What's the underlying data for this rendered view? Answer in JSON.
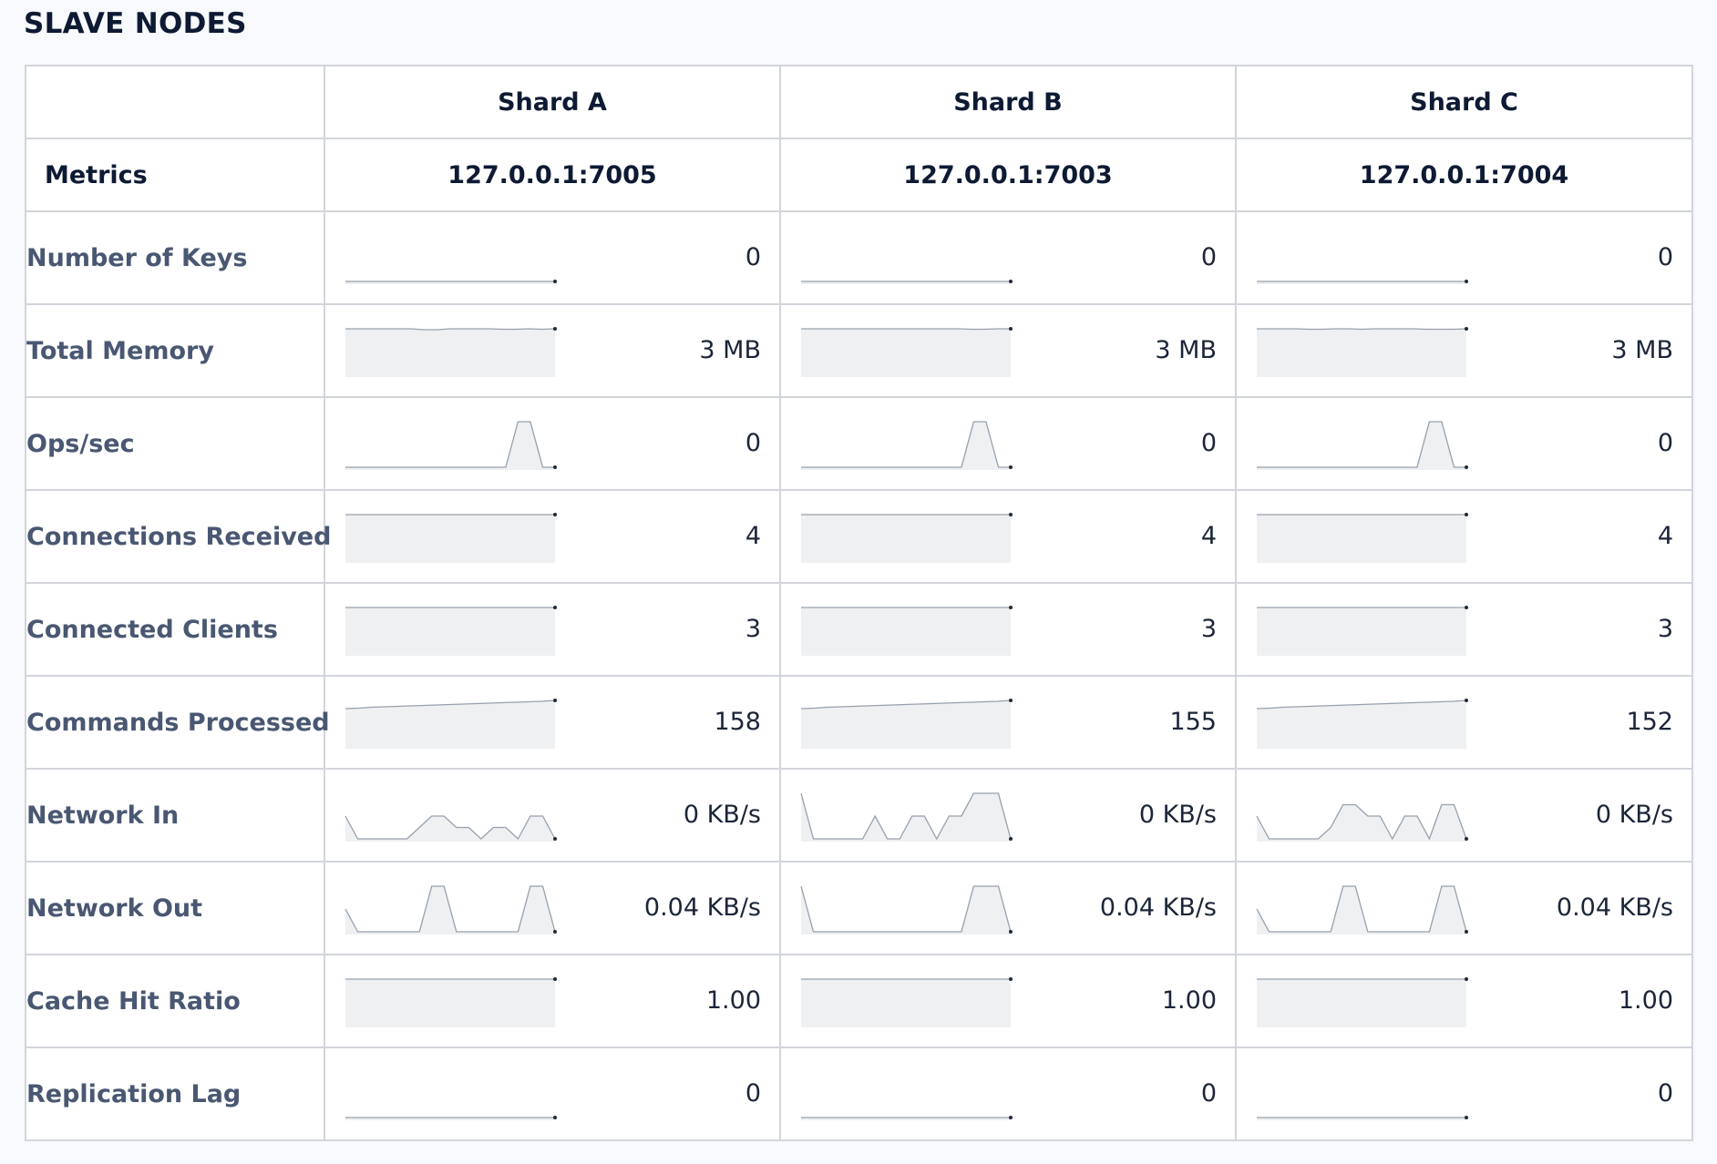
{
  "section_title": "SLAVE NODES",
  "metrics_label": "Metrics",
  "shards": [
    {
      "name": "Shard A",
      "address": "127.0.0.1:7005"
    },
    {
      "name": "Shard B",
      "address": "127.0.0.1:7003"
    },
    {
      "name": "Shard C",
      "address": "127.0.0.1:7004"
    }
  ],
  "rows": [
    {
      "label": "Number of Keys",
      "values": [
        "0",
        "0",
        "0"
      ],
      "series": [
        [
          0,
          0,
          0,
          0,
          0,
          0,
          0,
          0,
          0,
          0,
          0,
          0,
          0,
          0,
          0,
          0,
          0
        ],
        [
          0,
          0,
          0,
          0,
          0,
          0,
          0,
          0,
          0,
          0,
          0,
          0,
          0,
          0,
          0,
          0,
          0
        ],
        [
          0,
          0,
          0,
          0,
          0,
          0,
          0,
          0,
          0,
          0,
          0,
          0,
          0,
          0,
          0,
          0,
          0
        ]
      ]
    },
    {
      "label": "Total Memory",
      "values": [
        "3 MB",
        "3 MB",
        "3 MB"
      ],
      "series": [
        [
          1,
          1,
          1,
          1,
          1,
          1,
          0.98,
          0.98,
          1,
          1,
          1,
          1,
          0.99,
          0.99,
          1,
          0.99,
          1
        ],
        [
          1,
          1,
          1,
          1,
          1,
          1,
          1,
          1,
          1,
          1,
          1,
          1,
          1,
          0.99,
          0.99,
          1,
          1
        ],
        [
          1,
          1,
          1,
          1,
          0.99,
          0.99,
          1,
          1,
          0.99,
          1,
          1,
          1,
          1,
          0.99,
          0.99,
          0.99,
          1
        ]
      ]
    },
    {
      "label": "Ops/sec",
      "values": [
        "0",
        "0",
        "0"
      ],
      "series": [
        [
          0,
          0,
          0,
          0,
          0,
          0,
          0,
          0,
          0,
          0,
          0,
          0,
          0,
          0,
          1,
          1,
          0,
          0
        ],
        [
          0,
          0,
          0,
          0,
          0,
          0,
          0,
          0,
          0,
          0,
          0,
          0,
          0,
          0,
          1,
          1,
          0,
          0
        ],
        [
          0,
          0,
          0,
          0,
          0,
          0,
          0,
          0,
          0,
          0,
          0,
          0,
          0,
          0,
          1,
          1,
          0,
          0
        ]
      ]
    },
    {
      "label": "Connections Received",
      "values": [
        "4",
        "4",
        "4"
      ],
      "series": [
        [
          1,
          1,
          1,
          1,
          1,
          1,
          1,
          1,
          1,
          1,
          1,
          1,
          1,
          1,
          1,
          1,
          1
        ],
        [
          1,
          1,
          1,
          1,
          1,
          1,
          1,
          1,
          1,
          1,
          1,
          1,
          1,
          1,
          1,
          1,
          1
        ],
        [
          1,
          1,
          1,
          1,
          1,
          1,
          1,
          1,
          1,
          1,
          1,
          1,
          1,
          1,
          1,
          1,
          1
        ]
      ]
    },
    {
      "label": "Connected Clients",
      "values": [
        "3",
        "3",
        "3"
      ],
      "series": [
        [
          1,
          1,
          1,
          1,
          1,
          1,
          1,
          1,
          1,
          1,
          1,
          1,
          1,
          1,
          1,
          1,
          1
        ],
        [
          1,
          1,
          1,
          1,
          1,
          1,
          1,
          1,
          1,
          1,
          1,
          1,
          1,
          1,
          1,
          1,
          1
        ],
        [
          1,
          1,
          1,
          1,
          1,
          1,
          1,
          1,
          1,
          1,
          1,
          1,
          1,
          1,
          1,
          1,
          1
        ]
      ]
    },
    {
      "label": "Commands Processed",
      "values": [
        "158",
        "155",
        "152"
      ],
      "series": [
        [
          0.82,
          0.83,
          0.85,
          0.86,
          0.87,
          0.88,
          0.89,
          0.9,
          0.91,
          0.92,
          0.93,
          0.94,
          0.95,
          0.96,
          0.97,
          0.98,
          1
        ],
        [
          0.82,
          0.83,
          0.85,
          0.86,
          0.87,
          0.88,
          0.89,
          0.9,
          0.91,
          0.92,
          0.93,
          0.94,
          0.95,
          0.96,
          0.97,
          0.98,
          1
        ],
        [
          0.82,
          0.83,
          0.85,
          0.86,
          0.87,
          0.88,
          0.89,
          0.9,
          0.91,
          0.92,
          0.93,
          0.94,
          0.95,
          0.96,
          0.97,
          0.98,
          1
        ]
      ]
    },
    {
      "label": "Network In",
      "values": [
        "0 KB/s",
        "0 KB/s",
        "0 KB/s"
      ],
      "series": [
        [
          0.5,
          0,
          0,
          0,
          0,
          0,
          0.25,
          0.5,
          0.5,
          0.25,
          0.25,
          0,
          0.25,
          0.25,
          0,
          0.5,
          0.5,
          0
        ],
        [
          1,
          0,
          0,
          0,
          0,
          0,
          0.5,
          0,
          0,
          0.5,
          0.5,
          0,
          0.5,
          0.5,
          1,
          1,
          1,
          0
        ],
        [
          0.5,
          0,
          0,
          0,
          0,
          0,
          0.25,
          0.75,
          0.75,
          0.5,
          0.5,
          0,
          0.5,
          0.5,
          0,
          0.75,
          0.75,
          0
        ]
      ]
    },
    {
      "label": "Network Out",
      "values": [
        "0.04 KB/s",
        "0.04 KB/s",
        "0.04 KB/s"
      ],
      "series": [
        [
          0.5,
          0,
          0,
          0,
          0,
          0,
          0,
          1,
          1,
          0,
          0,
          0,
          0,
          0,
          0,
          1,
          1,
          0
        ],
        [
          1,
          0,
          0,
          0,
          0,
          0,
          0,
          0,
          0,
          0,
          0,
          0,
          0,
          0,
          1,
          1,
          1,
          0
        ],
        [
          0.5,
          0,
          0,
          0,
          0,
          0,
          0,
          1,
          1,
          0,
          0,
          0,
          0,
          0,
          0,
          1,
          1,
          0
        ]
      ]
    },
    {
      "label": "Cache Hit Ratio",
      "values": [
        "1.00",
        "1.00",
        "1.00"
      ],
      "series": [
        [
          1,
          1,
          1,
          1,
          1,
          1,
          1,
          1,
          1,
          1,
          1,
          1,
          1,
          1,
          1,
          1,
          1
        ],
        [
          1,
          1,
          1,
          1,
          1,
          1,
          1,
          1,
          1,
          1,
          1,
          1,
          1,
          1,
          1,
          1,
          1
        ],
        [
          1,
          1,
          1,
          1,
          1,
          1,
          1,
          1,
          1,
          1,
          1,
          1,
          1,
          1,
          1,
          1,
          1
        ]
      ]
    },
    {
      "label": "Replication Lag",
      "values": [
        "0",
        "0",
        "0"
      ],
      "series": [
        [
          0,
          0,
          0,
          0,
          0,
          0,
          0,
          0,
          0,
          0,
          0,
          0,
          0,
          0,
          0,
          0,
          0
        ],
        [
          0,
          0,
          0,
          0,
          0,
          0,
          0,
          0,
          0,
          0,
          0,
          0,
          0,
          0,
          0,
          0,
          0
        ],
        [
          0,
          0,
          0,
          0,
          0,
          0,
          0,
          0,
          0,
          0,
          0,
          0,
          0,
          0,
          0,
          0,
          0
        ]
      ]
    }
  ]
}
